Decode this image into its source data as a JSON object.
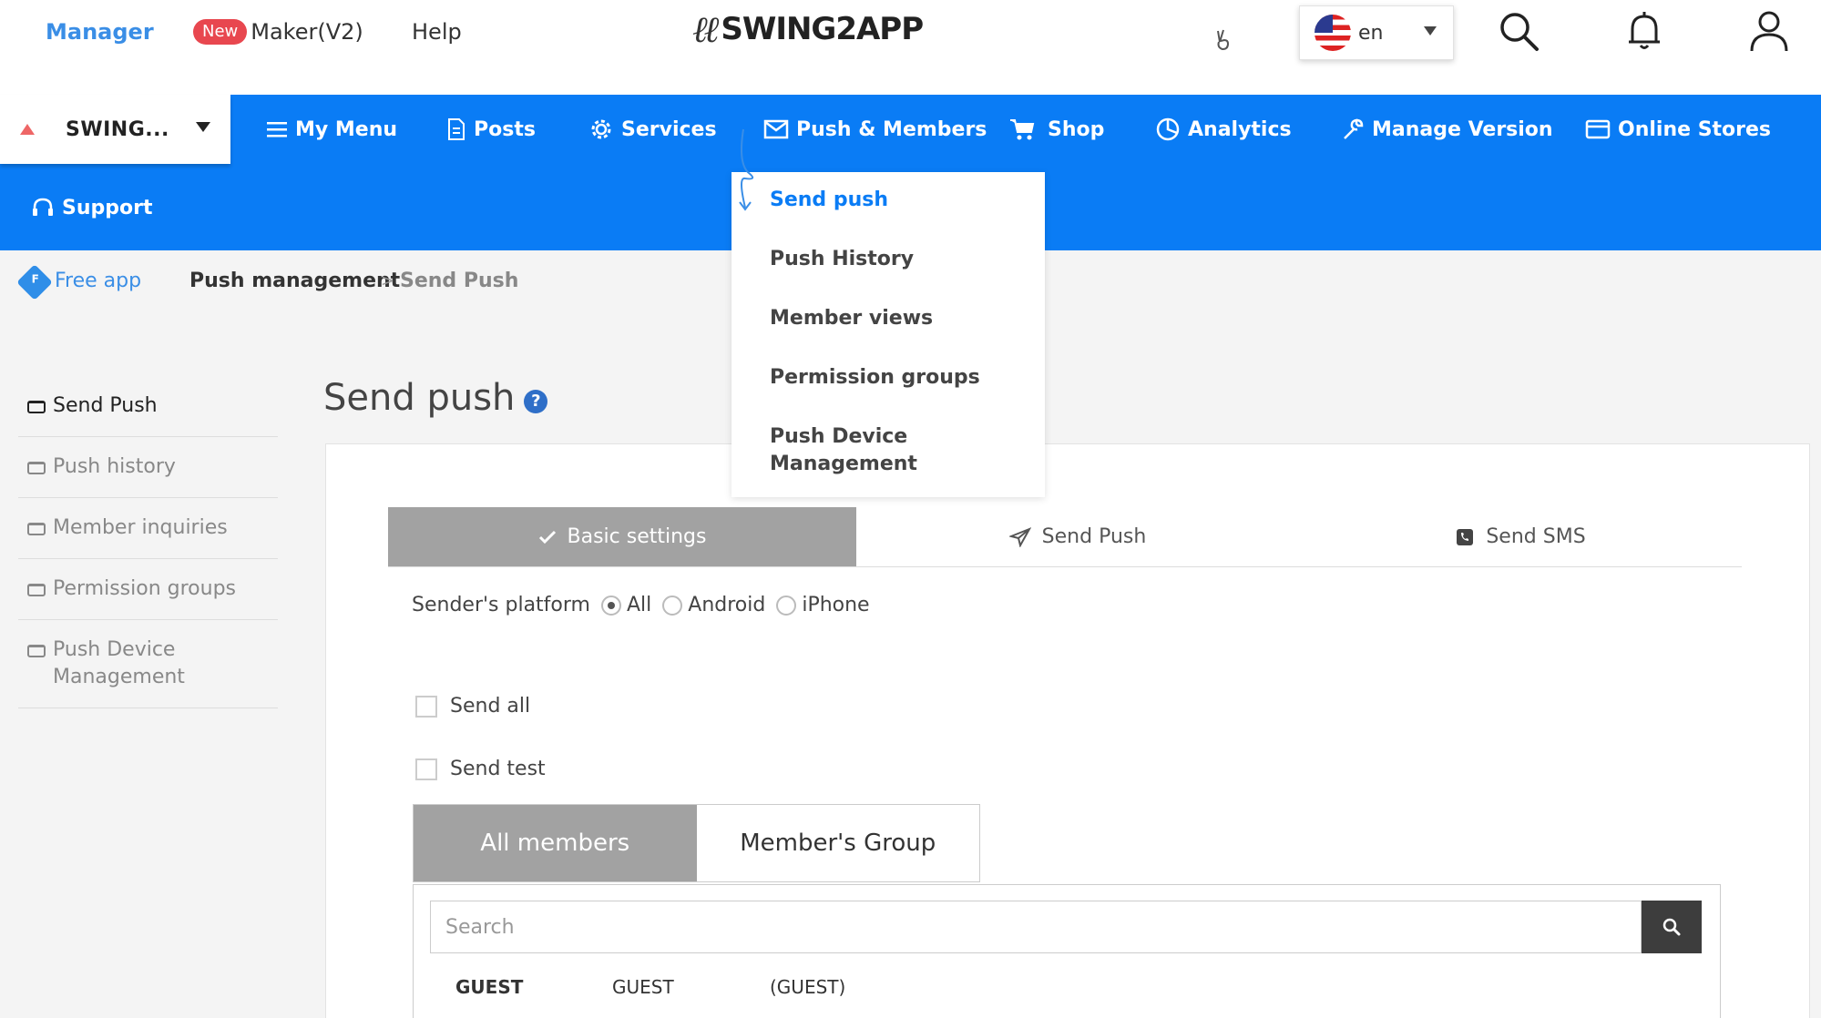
{
  "topbar": {
    "manager": "Manager",
    "new_badge": "New",
    "maker": "Maker(V2)",
    "help": "Help",
    "logo_text": "SWING2APP",
    "language": "en"
  },
  "nav": {
    "app_name": "SWING...",
    "items": [
      {
        "label": "My Menu",
        "icon": "menu-icon"
      },
      {
        "label": "Posts",
        "icon": "document-icon"
      },
      {
        "label": "Services",
        "icon": "gear-icon"
      },
      {
        "label": "Push & Members",
        "icon": "envelope-icon"
      },
      {
        "label": "Shop",
        "icon": "cart-icon"
      },
      {
        "label": "Analytics",
        "icon": "pie-chart-icon"
      },
      {
        "label": "Manage Version",
        "icon": "wrench-icon"
      },
      {
        "label": "Online Stores",
        "icon": "store-card-icon"
      }
    ],
    "support": "Support"
  },
  "dropdown": {
    "items": [
      "Send push",
      "Push History",
      "Member views",
      "Permission groups",
      "Push Device Management"
    ]
  },
  "breadcrumb": {
    "free_badge": "F",
    "free_app": "Free app",
    "section": "Push management",
    "separator": ">",
    "current": "Send Push"
  },
  "sidebar": {
    "items": [
      "Send Push",
      "Push history",
      "Member inquiries",
      "Permission groups",
      "Push Device Management"
    ],
    "active_index": 0
  },
  "main": {
    "title": "Send push",
    "help_mark": "?",
    "tabs": [
      "Basic settings",
      "Send Push",
      "Send SMS"
    ],
    "platform_label": "Sender's platform",
    "platform_options": [
      "All",
      "Android",
      "iPhone"
    ],
    "platform_selected": "All",
    "send_all": "Send all",
    "send_test": "Send test",
    "member_tabs": [
      "All members",
      "Member's Group"
    ],
    "search_placeholder": "Search",
    "guest_row": [
      "GUEST",
      "GUEST",
      "(GUEST)"
    ]
  },
  "colors": {
    "nav_blue": "#0a7cf5",
    "link_blue": "#3a8ee6",
    "badge_red": "#e8474f",
    "tab_gray": "#a2a2a2"
  }
}
